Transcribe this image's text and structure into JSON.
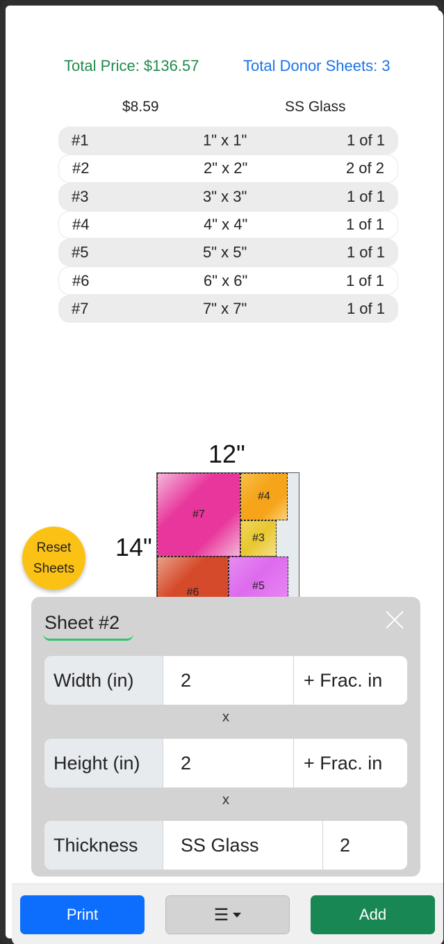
{
  "totals": {
    "price": "Total Price: $136.57",
    "donor_sheets": "Total Donor Sheets: 3"
  },
  "summary": {
    "price": "$8.59",
    "material": "SS Glass"
  },
  "rows": [
    {
      "id": "#1",
      "size": "1\" x 1\"",
      "count": "1 of 1"
    },
    {
      "id": "#2",
      "size": "2\" x 2\"",
      "count": "2 of 2"
    },
    {
      "id": "#3",
      "size": "3\" x 3\"",
      "count": "1 of 1"
    },
    {
      "id": "#4",
      "size": "4\" x 4\"",
      "count": "1 of 1"
    },
    {
      "id": "#5",
      "size": "5\" x 5\"",
      "count": "1 of 1"
    },
    {
      "id": "#6",
      "size": "6\" x 6\"",
      "count": "1 of 1"
    },
    {
      "id": "#7",
      "size": "7\" x 7\"",
      "count": "1 of 1"
    }
  ],
  "layout": {
    "width_label": "12\"",
    "height_label": "14\"",
    "pieces": [
      "#7",
      "#4",
      "#3",
      "#6",
      "#5"
    ]
  },
  "reset_button": {
    "line1": "Reset",
    "line2": "Sheets"
  },
  "panel": {
    "title": "Sheet #2",
    "width_label": "Width (in)",
    "width_value": "2",
    "width_suffix": "+ Frac. in",
    "times1": "x",
    "height_label": "Height (in)",
    "height_value": "2",
    "height_suffix": "+ Frac. in",
    "times2": "x",
    "thickness_label": "Thickness",
    "thickness_value": "SS Glass",
    "quantity_value": "2"
  },
  "footer": {
    "print_label": "Print",
    "menu_label": "☰",
    "add_label": "Add"
  },
  "colors": {
    "price_green": "#1f8a4c",
    "sheets_blue": "#1a73e8",
    "print_blue": "#0d6efd",
    "add_green": "#198754",
    "reset_yellow": "#fbc114",
    "underline_green": "#2ec56a"
  }
}
